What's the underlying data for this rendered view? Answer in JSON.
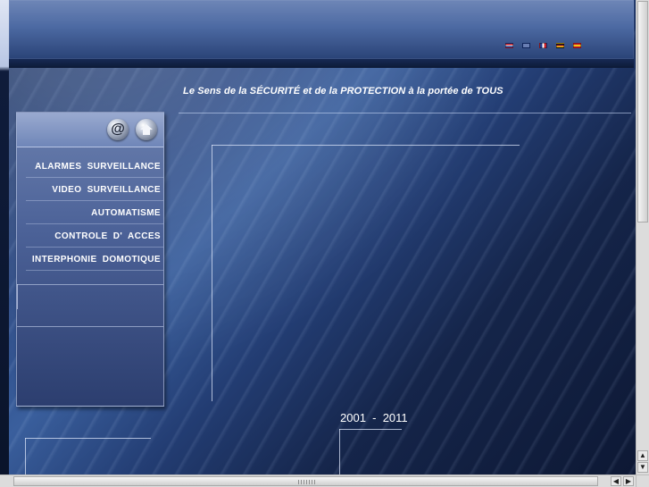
{
  "header": {
    "flags": [
      {
        "name": "flag-nl-icon"
      },
      {
        "name": "flag-gb-icon"
      },
      {
        "name": "flag-fr-icon"
      },
      {
        "name": "flag-de-icon"
      },
      {
        "name": "flag-es-icon"
      }
    ],
    "tagline": "Le Sens de la  SÉCURITÉ et de la PROTECTION  à la portée de TOUS"
  },
  "sidebar": {
    "at_label": "@",
    "items": [
      {
        "label": "ALARMES  SURVEILLANCE"
      },
      {
        "label": "VIDEO  SURVEILLANCE"
      },
      {
        "label": "AUTOMATISME"
      },
      {
        "label": "CONTROLE  D' ACCES"
      },
      {
        "label": "INTERPHONIE  DOMOTIQUE"
      }
    ]
  },
  "footer": {
    "years": "2001  -  2011"
  },
  "scrollbars": {
    "up": "▲",
    "down": "▼",
    "left": "◀",
    "right": "▶"
  },
  "colors": {
    "background_deep": "#0d1834",
    "background_mid": "#3a5f9d",
    "panel": "#4c6298",
    "text": "#ffffff"
  }
}
